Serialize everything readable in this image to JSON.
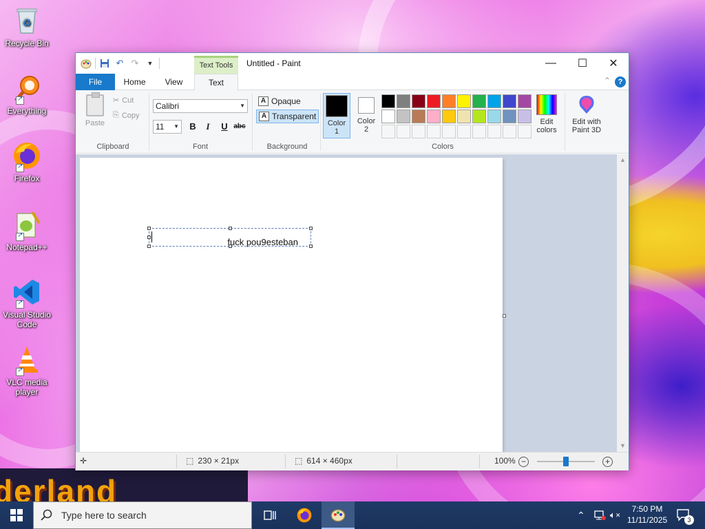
{
  "desktop": {
    "icons": [
      {
        "label": "Recycle Bin"
      },
      {
        "label": "Everything"
      },
      {
        "label": "Firefox"
      },
      {
        "label": "Notepad++"
      },
      {
        "label": "Visual Studio Code"
      },
      {
        "label": "VLC media player"
      }
    ],
    "wallpaper_text": "derland"
  },
  "window": {
    "title": "Untitled - Paint",
    "context_tab_group": "Text Tools"
  },
  "tabs": {
    "file": "File",
    "home": "Home",
    "view": "View",
    "text": "Text"
  },
  "clipboard": {
    "paste": "Paste",
    "cut": "Cut",
    "copy": "Copy",
    "label": "Clipboard"
  },
  "font": {
    "family": "Calibri",
    "size": "11",
    "bold": "B",
    "italic": "I",
    "underline": "U",
    "strike": "abc",
    "label": "Font"
  },
  "background": {
    "opaque": "Opaque",
    "transparent": "Transparent",
    "label": "Background"
  },
  "colors": {
    "color1": "Color 1",
    "color1_line1": "Color",
    "color1_line2": "1",
    "color2_line1": "Color",
    "color2_line2": "2",
    "color1_value": "#000000",
    "color2_value": "#ffffff",
    "edit_line1": "Edit",
    "edit_line2": "colors",
    "paint3d_line1": "Edit with",
    "paint3d_line2": "Paint 3D",
    "label": "Colors",
    "palette_row1": [
      "#000000",
      "#7f7f7f",
      "#880015",
      "#ed1c24",
      "#ff7f27",
      "#fff200",
      "#22b14c",
      "#00a2e8",
      "#3f48cc",
      "#a349a4"
    ],
    "palette_row2": [
      "#ffffff",
      "#c3c3c3",
      "#b97a57",
      "#ffaec9",
      "#ffc90e",
      "#efe4b0",
      "#b5e61d",
      "#99d9ea",
      "#7092be",
      "#c8bfe7"
    ]
  },
  "canvas": {
    "text": "fuck pou9esteban"
  },
  "status": {
    "selection_size": "230 × 21px",
    "image_size": "614 × 460px",
    "zoom": "100%"
  },
  "taskbar": {
    "search_placeholder": "Type here to search",
    "time": "7:50 PM",
    "date": "11/11/2025",
    "notifications": "3"
  }
}
